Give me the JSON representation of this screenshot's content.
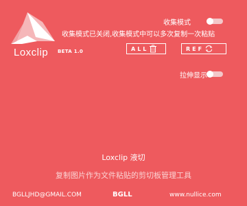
{
  "app": {
    "name": "Loxclip",
    "version_badge": "BETA 1.0"
  },
  "settings": {
    "collect_mode_label": "收集模式",
    "collect_mode_on": false,
    "collect_mode_hint": "收集模式已关闭,收集模式中可以多次复制一次粘贴",
    "stretch_display_label": "拉伸显示",
    "stretch_display_on": false
  },
  "buttons": {
    "all_label": "ALL",
    "ref_label": "REF"
  },
  "about": {
    "title": "Loxclip 液切",
    "description": "复制图片作为文件粘贴的剪切板管理工具"
  },
  "footer": {
    "email": "BGLLJHD@GMAIL.COM",
    "author": "BGLL",
    "website": "www.nullice.com"
  },
  "colors": {
    "background": "#ee5a5e",
    "toggle_off": "#f3c7c9"
  },
  "icons": {
    "logo": "triangle-logo",
    "all": "trash-icon",
    "ref": "refresh-icon"
  }
}
